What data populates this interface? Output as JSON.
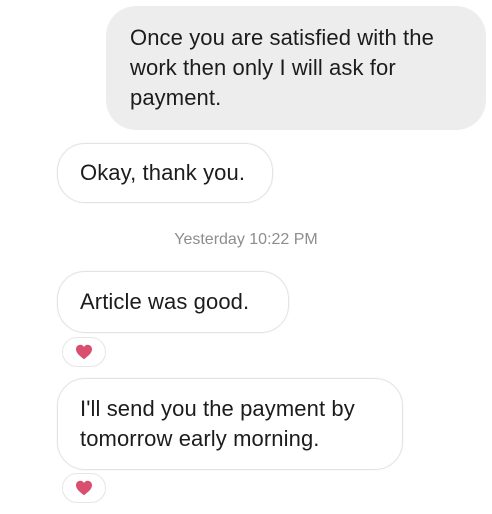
{
  "messages": [
    {
      "direction": "sent",
      "text": "Once you are satisfied with the\nwork then only I will ask for\npayment."
    },
    {
      "direction": "received",
      "text": "Okay, thank you."
    },
    {
      "direction": "received",
      "text": "Article was good.",
      "reaction": "heart-icon"
    },
    {
      "direction": "received",
      "text": "I'll send you the payment by\ntomorrow early morning.",
      "reaction": "heart-icon"
    }
  ],
  "timestamp": "Yesterday 10:22 PM",
  "colors": {
    "sent_bubble": "#ededed",
    "received_bubble": "#ffffff",
    "reaction_heart": "#d9506e",
    "timestamp_text": "#8d8d8d"
  }
}
